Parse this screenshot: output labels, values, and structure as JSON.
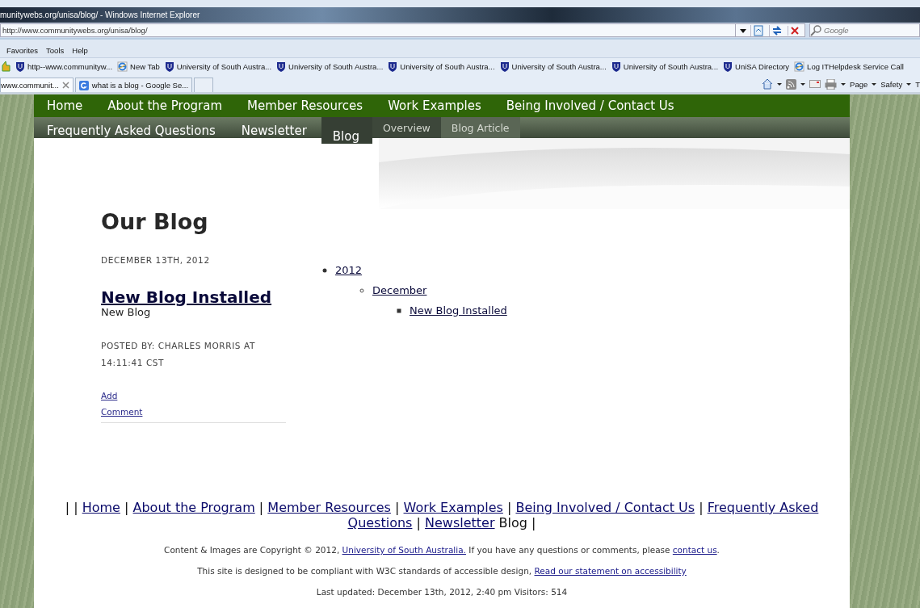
{
  "browser": {
    "title": "munitywebs.org/unisa/blog/ - Windows Internet Explorer",
    "address": "http://www.communitywebs.org/unisa/blog/",
    "search": {
      "placeholder": "Google"
    },
    "menu": [
      "Favorites",
      "Tools",
      "Help"
    ],
    "favorites": [
      {
        "label": "http--www.communityw...",
        "kind": "shield"
      },
      {
        "label": "New Tab",
        "kind": "ie"
      },
      {
        "label": "University of South Austra...",
        "kind": "shield"
      },
      {
        "label": "University of South Austra...",
        "kind": "shield"
      },
      {
        "label": "University of South Austra...",
        "kind": "shield"
      },
      {
        "label": "University of South Austra...",
        "kind": "shield"
      },
      {
        "label": "University of South Austra...",
        "kind": "shield"
      },
      {
        "label": "UniSA Directory",
        "kind": "shield"
      },
      {
        "label": "Log ITHelpdesk Service Call",
        "kind": "ie"
      }
    ],
    "tabs": [
      {
        "label": "www.communit...",
        "selected": true
      },
      {
        "label": "what is a blog - Google Se...",
        "selected": false
      }
    ],
    "commands": [
      "Page",
      "Safety",
      "T"
    ]
  },
  "site": {
    "nav": [
      {
        "label": "Home"
      },
      {
        "label": "About the Program"
      },
      {
        "label": "Member Resources"
      },
      {
        "label": "Work Examples"
      },
      {
        "label": "Being Involved / Contact Us"
      }
    ],
    "subnav": [
      {
        "label": "Frequently Asked Questions",
        "selected": false
      },
      {
        "label": "Newsletter",
        "selected": false
      },
      {
        "label": "Blog",
        "selected": true
      }
    ],
    "section_nav": [
      {
        "label": "Overview",
        "selected": true
      },
      {
        "label": "Blog Article",
        "selected": false
      }
    ],
    "heading": "Our Blog",
    "post": {
      "date": "DECEMBER 13TH, 2012",
      "title": "New Blog Installed",
      "summary": "New Blog",
      "byline": "POSTED BY: CHARLES MORRIS AT 14:11:41 CST",
      "comment_link": "Add Comment"
    },
    "archive": [
      {
        "label": "2012",
        "children": [
          {
            "label": "December",
            "children": [
              {
                "label": "New Blog Installed"
              }
            ]
          }
        ]
      }
    ],
    "footer_nav": [
      {
        "text": "|",
        "kind": "text"
      },
      {
        "text": "|",
        "kind": "text"
      },
      {
        "text": "Home",
        "kind": "link"
      },
      {
        "text": "|",
        "kind": "text"
      },
      {
        "text": "About the Program",
        "kind": "link"
      },
      {
        "text": "|",
        "kind": "text"
      },
      {
        "text": "Member Resources",
        "kind": "link"
      },
      {
        "text": "|",
        "kind": "text"
      },
      {
        "text": "Work Examples",
        "kind": "link"
      },
      {
        "text": "|",
        "kind": "text"
      },
      {
        "text": "Being Involved / Contact Us",
        "kind": "link"
      },
      {
        "text": "|",
        "kind": "text"
      },
      {
        "text": "Frequently Asked",
        "kind": "link"
      },
      {
        "text": "Questions",
        "kind": "link"
      },
      {
        "text": "|",
        "kind": "text"
      },
      {
        "text": "Newsletter",
        "kind": "link"
      },
      {
        "text": "Blog |",
        "kind": "text"
      }
    ],
    "footer_lines": [
      [
        {
          "text": "Content & Images are Copyright © 2012, ",
          "kind": "text"
        },
        {
          "text": "University of South Australia.",
          "kind": "link"
        },
        {
          "text": " If you have any questions or comments, please ",
          "kind": "text"
        },
        {
          "text": "contact us",
          "kind": "link"
        },
        {
          "text": ".",
          "kind": "text"
        }
      ],
      [
        {
          "text": "This site is designed to be compliant with W3C standards of accessible design, ",
          "kind": "text"
        },
        {
          "text": "Read our statement on accessibility",
          "kind": "link"
        }
      ],
      [
        {
          "text": "Last updated: December 13th, 2012, 2:40 pm Visitors: 514",
          "kind": "text"
        }
      ]
    ]
  }
}
